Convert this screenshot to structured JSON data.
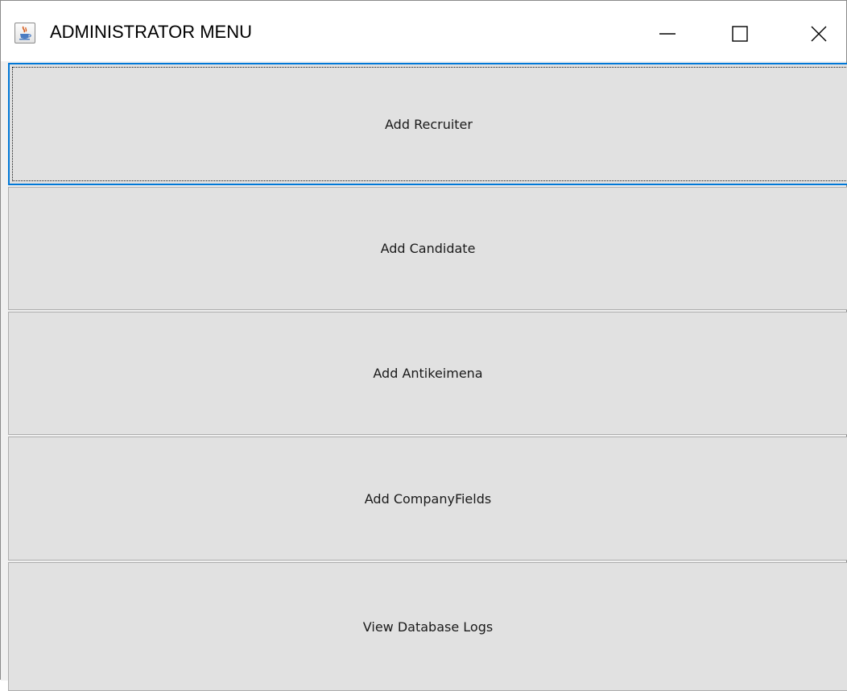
{
  "window": {
    "title": "ADMINISTRATOR MENU",
    "icon": "java-icon",
    "controls": {
      "minimize_icon": "minimize-icon",
      "maximize_icon": "maximize-icon",
      "close_icon": "close-icon"
    }
  },
  "menu": {
    "buttons": [
      {
        "label": "Add Recruiter",
        "focused": true
      },
      {
        "label": "Add Candidate",
        "focused": false
      },
      {
        "label": "Add Antikeimena",
        "focused": false
      },
      {
        "label": "Add CompanyFields",
        "focused": false
      },
      {
        "label": "View Database Logs",
        "focused": false
      }
    ]
  },
  "colors": {
    "focus_border": "#0078d7",
    "button_face": "#e1e1e1",
    "button_border": "#adadad"
  }
}
